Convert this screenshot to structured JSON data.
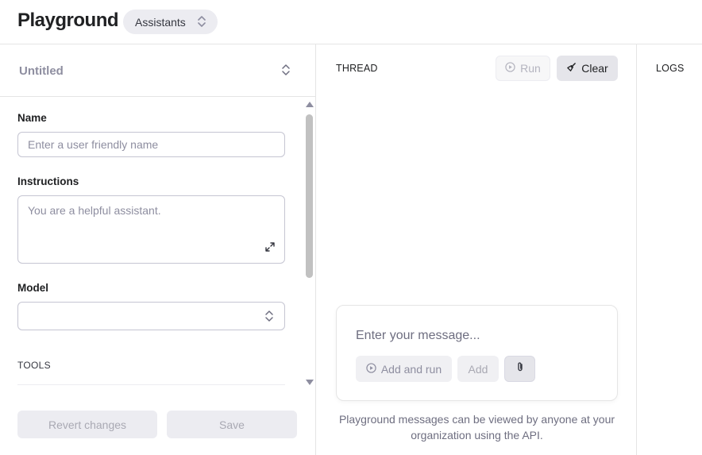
{
  "header": {
    "title": "Playground",
    "mode_select": {
      "value": "Assistants",
      "icon": "chevron-up-down-icon"
    }
  },
  "assistant_panel": {
    "selector": {
      "value": "Untitled",
      "icon": "chevron-up-down-icon"
    },
    "name": {
      "label": "Name",
      "placeholder": "Enter a user friendly name",
      "value": ""
    },
    "instructions": {
      "label": "Instructions",
      "placeholder": "You are a helpful assistant.",
      "value": "",
      "icon": "expand-icon"
    },
    "model": {
      "label": "Model",
      "value": "",
      "icon": "chevron-up-down-icon"
    },
    "tools": {
      "label": "TOOLS"
    },
    "footer": {
      "revert_label": "Revert changes",
      "save_label": "Save"
    }
  },
  "thread_panel": {
    "title": "THREAD",
    "run_label": "Run",
    "run_icon": "play-circle-icon",
    "clear_label": "Clear",
    "clear_icon": "broom-icon",
    "composer": {
      "placeholder": "Enter your message...",
      "add_and_run_label": "Add and run",
      "add_and_run_icon": "play-circle-icon",
      "add_label": "Add",
      "attach_icon": "paperclip-icon"
    },
    "disclaimer": "Playground messages can be viewed by anyone at your organization using the API."
  },
  "logs_panel": {
    "title": "LOGS"
  },
  "colors": {
    "background": "#ffffff",
    "border": "#e5e5e5",
    "button_bg": "#ececf1",
    "text_primary": "#202123",
    "text_muted": "#8e8ea0"
  }
}
